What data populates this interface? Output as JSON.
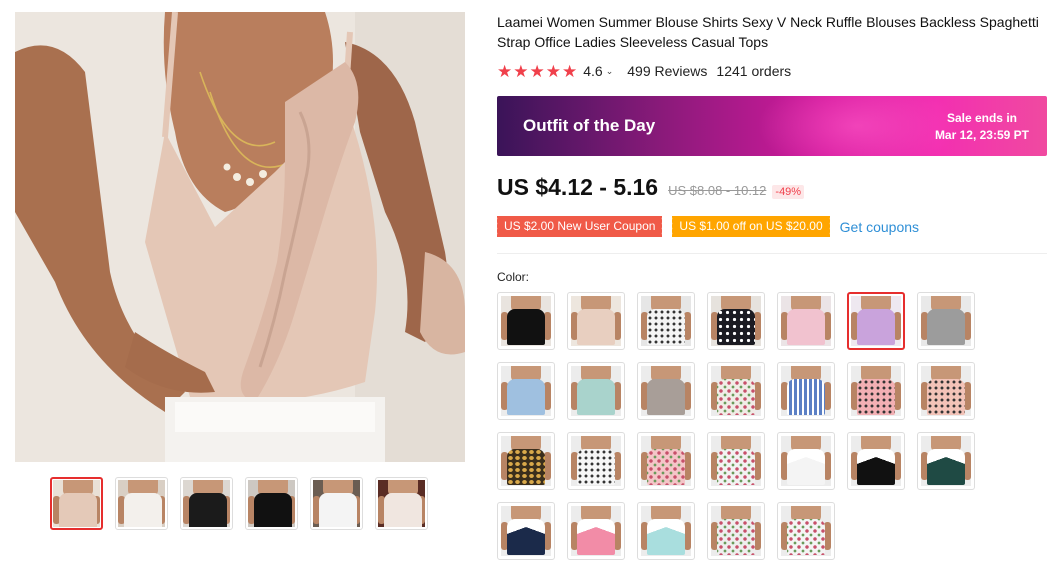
{
  "product": {
    "title": "Laamei Women Summer Blouse Shirts Sexy V Neck Ruffle Blouses Backless Spaghetti Strap Office Ladies Sleeveless Casual Tops",
    "rating": "4.6",
    "reviews": "499 Reviews",
    "orders": "1241 orders",
    "star_color": "#f0404b"
  },
  "banner": {
    "title": "Outfit of the Day",
    "sale_line1": "Sale ends in",
    "sale_line2": "Mar 12, 23:59 PT"
  },
  "pricing": {
    "price": "US $4.12 - 5.16",
    "original": "US $8.08 - 10.12",
    "discount": "-49%"
  },
  "coupons": {
    "new_user": "US $2.00 New User Coupon",
    "store": "US $1.00 off on US $20.00",
    "get_link": "Get coupons"
  },
  "colors": {
    "label": "Color:",
    "selected_index": 5,
    "swatches": [
      {
        "top": "#111111",
        "bg": "#e9e4df"
      },
      {
        "top": "#e8cfc0",
        "bg": "#ede6de"
      },
      {
        "top": "#f4f4f4",
        "bg": "#e6e6e6",
        "pattern": "dots-dark"
      },
      {
        "top": "#1b1b22",
        "bg": "#e6e2dd",
        "pattern": "dots-light"
      },
      {
        "top": "#f1c2cf",
        "bg": "#ebe4e6"
      },
      {
        "top": "#c9a3dc",
        "bg": "#eee8f0"
      },
      {
        "top": "#9c9c9c",
        "bg": "#e9e9e9"
      },
      {
        "top": "#9fc0e0",
        "bg": "#ececec"
      },
      {
        "top": "#a9d3cc",
        "bg": "#ececec"
      },
      {
        "top": "#a89e98",
        "bg": "#ececec"
      },
      {
        "top": "#f0ece6",
        "bg": "#ececec",
        "pattern": "floral"
      },
      {
        "top": "#5b7fc4",
        "bg": "#ececec",
        "pattern": "stripes"
      },
      {
        "top": "#f3b0b4",
        "bg": "#ececec",
        "pattern": "dots-dark"
      },
      {
        "top": "#f3c3b8",
        "bg": "#ececec",
        "pattern": "dots-dark"
      },
      {
        "top": "#3a2e1c",
        "bg": "#ececec",
        "pattern": "leopard"
      },
      {
        "top": "#f6f6f6",
        "bg": "#ececec",
        "pattern": "dots-dark"
      },
      {
        "top": "#f4c5c8",
        "bg": "#ececec",
        "pattern": "floral"
      },
      {
        "top": "#f2f2f2",
        "bg": "#ececec",
        "pattern": "floral"
      },
      {
        "top": "#f4f4f4",
        "bg": "#ececec",
        "pattern": "lace"
      },
      {
        "top": "#111111",
        "bg": "#ececec",
        "pattern": "lace"
      },
      {
        "top": "#1f4a44",
        "bg": "#ececec",
        "pattern": "lace"
      },
      {
        "top": "#1b2a4a",
        "bg": "#ececec",
        "pattern": "lace"
      },
      {
        "top": "#f28ca7",
        "bg": "#ececec",
        "pattern": "lace"
      },
      {
        "top": "#a9dede",
        "bg": "#ececec",
        "pattern": "lace"
      },
      {
        "top": "#eeeeee",
        "bg": "#ececec",
        "pattern": "floral"
      },
      {
        "top": "#f4f4f4",
        "bg": "#ececec",
        "pattern": "floral"
      }
    ]
  },
  "gallery": {
    "selected_index": 0,
    "thumbs": [
      {
        "top": "#e4c9b8",
        "bg": "#e9e0d6"
      },
      {
        "top": "#f3f0ec",
        "bg": "#d9cfc4"
      },
      {
        "top": "#1b1b1b",
        "bg": "#dcd7d1"
      },
      {
        "top": "#111111",
        "bg": "#cdc8c2"
      },
      {
        "top": "#f4f4f4",
        "bg": "#6b5d52"
      },
      {
        "top": "#f0e6e0",
        "bg": "#5a2c24"
      }
    ]
  }
}
